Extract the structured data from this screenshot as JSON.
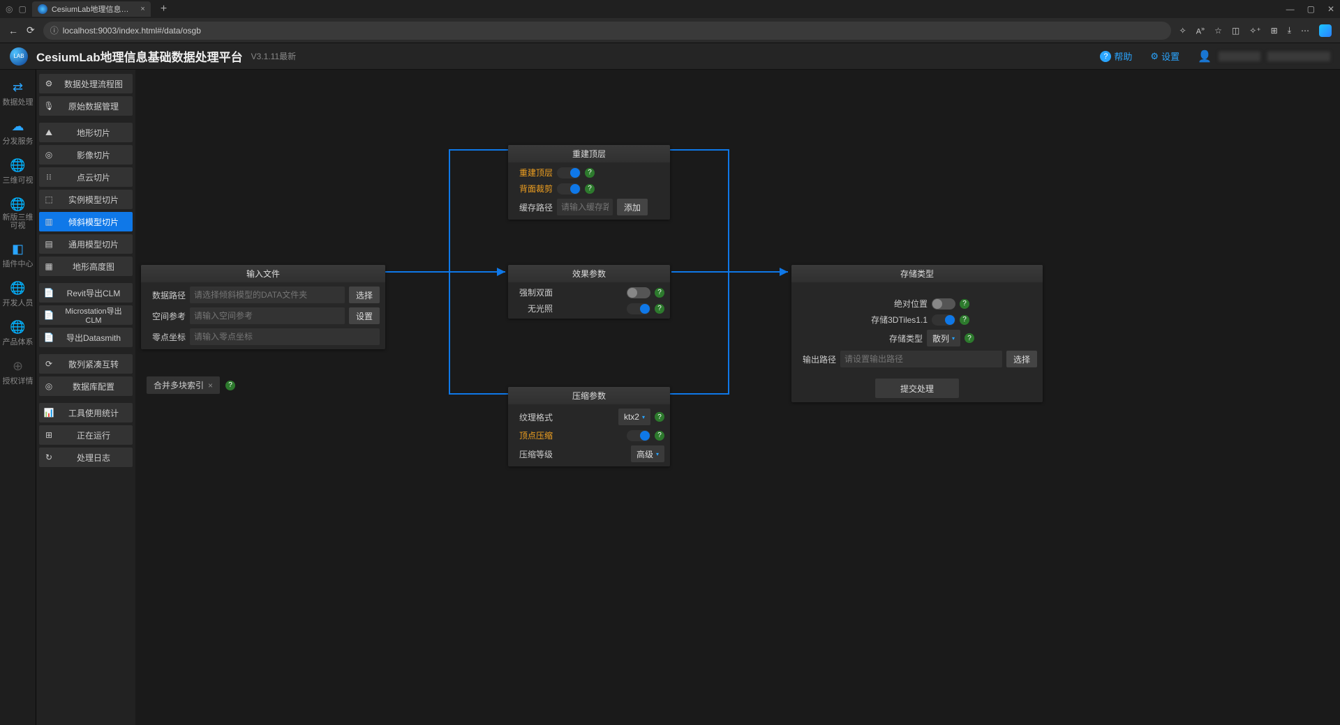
{
  "browser": {
    "tab_title": "CesiumLab地理信息基础数据处…",
    "url": "localhost:9003/index.html#/data/osgb"
  },
  "header": {
    "title": "CesiumLab地理信息基础数据处理平台",
    "version": "V3.1.11最新",
    "help": "帮助",
    "settings": "设置"
  },
  "rail": [
    {
      "label": "数据处理",
      "icon": "⇄"
    },
    {
      "label": "分发服务",
      "icon": "☁"
    },
    {
      "label": "三维可视",
      "icon": "🌐"
    },
    {
      "label": "新版三维可视",
      "icon": "🌐"
    },
    {
      "label": "插件中心",
      "icon": "◧"
    },
    {
      "label": "开发人员",
      "icon": "🌐"
    },
    {
      "label": "产品体系",
      "icon": "🌐"
    },
    {
      "label": "授权详情",
      "icon": "⊕"
    }
  ],
  "sidebar": {
    "g1": [
      {
        "icon": "⚙",
        "label": "数据处理流程图"
      },
      {
        "icon": "🎙",
        "label": "原始数据管理"
      }
    ],
    "g2": [
      {
        "icon": "⛰",
        "label": "地形切片"
      },
      {
        "icon": "◎",
        "label": "影像切片"
      },
      {
        "icon": "⁝⁝",
        "label": "点云切片"
      },
      {
        "icon": "⬚",
        "label": "实例模型切片"
      },
      {
        "icon": "▥",
        "label": "倾斜模型切片",
        "active": true
      },
      {
        "icon": "▤",
        "label": "通用模型切片"
      },
      {
        "icon": "▦",
        "label": "地形高度图"
      }
    ],
    "g3": [
      {
        "icon": "📄",
        "label": "Revit导出CLM"
      },
      {
        "icon": "📄",
        "label": "Microstation导出CLM"
      },
      {
        "icon": "📄",
        "label": "导出Datasmith"
      }
    ],
    "g4": [
      {
        "icon": "⟳",
        "label": "散列紧凑互转"
      },
      {
        "icon": "◎",
        "label": "数据库配置"
      }
    ],
    "g5": [
      {
        "icon": "📊",
        "label": "工具使用统计"
      },
      {
        "icon": "⊞",
        "label": "正在运行"
      },
      {
        "icon": "↻",
        "label": "处理日志"
      }
    ]
  },
  "panels": {
    "input": {
      "title": "输入文件",
      "data_path_label": "数据路径",
      "data_path_placeholder": "请选择倾斜模型的DATA文件夹",
      "select_btn": "选择",
      "srs_label": "空间参考",
      "srs_placeholder": "请输入空间参考",
      "set_btn": "设置",
      "origin_label": "零点坐标",
      "origin_placeholder": "请输入零点坐标",
      "merge_label": "合并多块索引"
    },
    "rebuild": {
      "title": "重建顶层",
      "rebuild_label": "重建顶层",
      "backface_label": "背面裁剪",
      "cache_label": "缓存路径",
      "cache_placeholder": "请输入缓存路径",
      "add_btn": "添加"
    },
    "effect": {
      "title": "效果参数",
      "force_double_label": "强制双面",
      "no_light_label": "无光照"
    },
    "compress": {
      "title": "压缩参数",
      "texture_label": "纹理格式",
      "texture_value": "ktx2",
      "vertex_label": "顶点压缩",
      "level_label": "压缩等级",
      "level_value": "高级"
    },
    "storage": {
      "title": "存储类型",
      "abs_pos_label": "绝对位置",
      "tiles11_label": "存储3DTiles1.1",
      "type_label": "存储类型",
      "type_value": "散列",
      "out_path_label": "输出路径",
      "out_path_placeholder": "请设置输出路径",
      "select_btn": "选择",
      "submit_btn": "提交处理"
    }
  }
}
